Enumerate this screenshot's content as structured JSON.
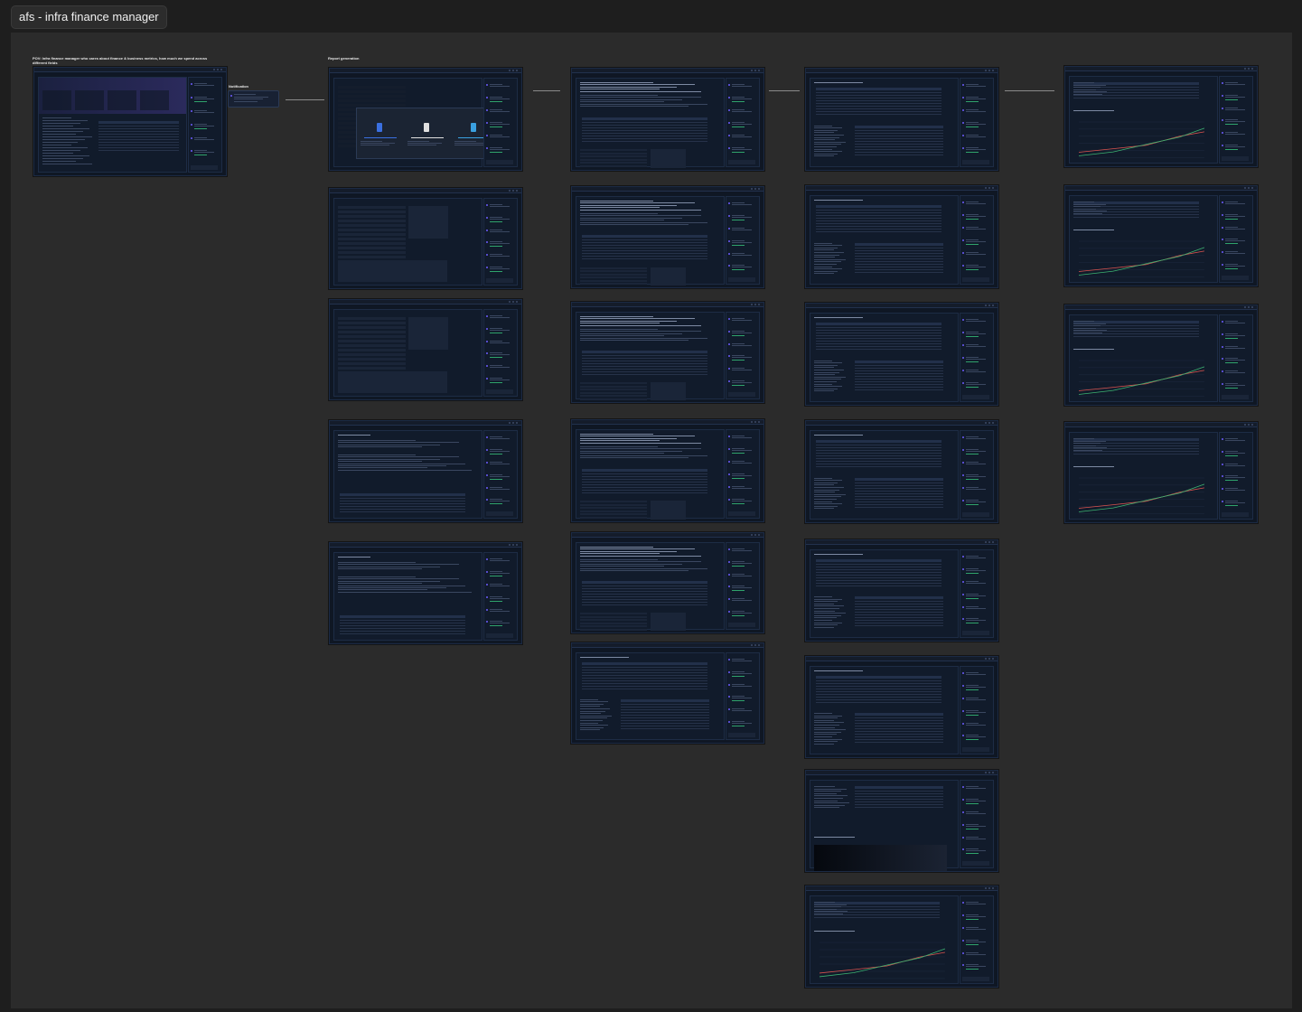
{
  "board": {
    "title": "afs - infra finance manager"
  },
  "sections": {
    "pov": "POV: Infra finance manager who cares about finance & business metrics, how much we spend across different fields",
    "notification": "Notification",
    "report_generation": "Report generation"
  },
  "colors": {
    "canvas": "#2b2b2b",
    "frame_bg": "#0f1724",
    "accent": "#6d5cff",
    "positive": "#2fa36b",
    "chart_line_a": "#d9534f",
    "chart_line_b": "#3cb371"
  }
}
